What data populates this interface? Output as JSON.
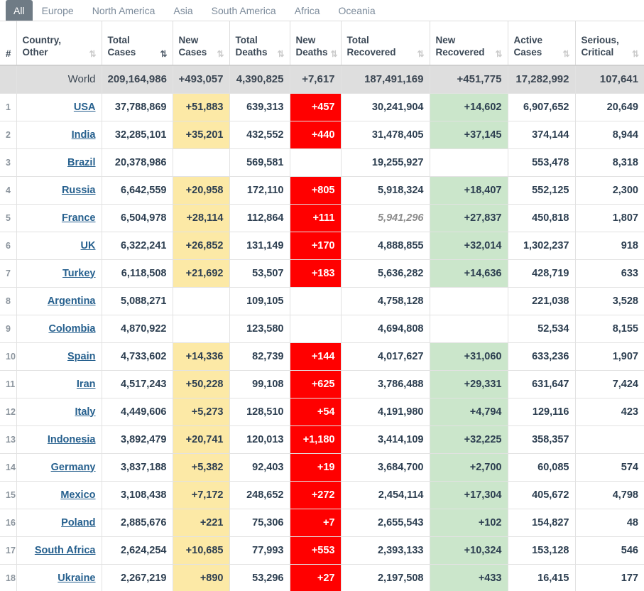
{
  "tabs": [
    {
      "label": "All",
      "active": true
    },
    {
      "label": "Europe",
      "active": false
    },
    {
      "label": "North America",
      "active": false
    },
    {
      "label": "Asia",
      "active": false
    },
    {
      "label": "South America",
      "active": false
    },
    {
      "label": "Africa",
      "active": false
    },
    {
      "label": "Oceania",
      "active": false
    }
  ],
  "columns": [
    {
      "label": "#",
      "sort": "none"
    },
    {
      "label": "Country,\nOther",
      "line1": "Country,",
      "line2": "Other",
      "sort": "both"
    },
    {
      "label": "Total Cases",
      "line1": "Total",
      "line2": "Cases",
      "sort": "desc-active"
    },
    {
      "label": "New Cases",
      "line1": "New",
      "line2": "Cases",
      "sort": "both"
    },
    {
      "label": "Total Deaths",
      "line1": "Total",
      "line2": "Deaths",
      "sort": "both"
    },
    {
      "label": "New Deaths",
      "line1": "New",
      "line2": "Deaths",
      "sort": "both"
    },
    {
      "label": "Total Recovered",
      "line1": "Total",
      "line2": "Recovered",
      "sort": "both"
    },
    {
      "label": "New Recovered",
      "line1": "New",
      "line2": "Recovered",
      "sort": "both"
    },
    {
      "label": "Active Cases",
      "line1": "Active",
      "line2": "Cases",
      "sort": "both"
    },
    {
      "label": "Serious, Critical",
      "line1": "Serious,",
      "line2": "Critical",
      "sort": "both"
    }
  ],
  "sort_icons": {
    "both": "⇅",
    "desc_active": "⇅",
    "none": ""
  },
  "world_row": {
    "rank": "",
    "country": "World",
    "total_cases": "209,164,986",
    "new_cases": "+493,057",
    "total_deaths": "4,390,825",
    "new_deaths": "+7,617",
    "total_recovered": "187,491,169",
    "new_recovered": "+451,775",
    "active_cases": "17,282,992",
    "serious_critical": "107,641"
  },
  "rows": [
    {
      "rank": "1",
      "country": "USA",
      "total_cases": "37,788,869",
      "new_cases": "+51,883",
      "total_deaths": "639,313",
      "new_deaths": "+457",
      "total_recovered": "30,241,904",
      "new_recovered": "+14,602",
      "active_cases": "6,907,652",
      "serious_critical": "20,649",
      "recovered_estimated": false
    },
    {
      "rank": "2",
      "country": "India",
      "total_cases": "32,285,101",
      "new_cases": "+35,201",
      "total_deaths": "432,552",
      "new_deaths": "+440",
      "total_recovered": "31,478,405",
      "new_recovered": "+37,145",
      "active_cases": "374,144",
      "serious_critical": "8,944",
      "recovered_estimated": false
    },
    {
      "rank": "3",
      "country": "Brazil",
      "total_cases": "20,378,986",
      "new_cases": "",
      "total_deaths": "569,581",
      "new_deaths": "",
      "total_recovered": "19,255,927",
      "new_recovered": "",
      "active_cases": "553,478",
      "serious_critical": "8,318",
      "recovered_estimated": false
    },
    {
      "rank": "4",
      "country": "Russia",
      "total_cases": "6,642,559",
      "new_cases": "+20,958",
      "total_deaths": "172,110",
      "new_deaths": "+805",
      "total_recovered": "5,918,324",
      "new_recovered": "+18,407",
      "active_cases": "552,125",
      "serious_critical": "2,300",
      "recovered_estimated": false
    },
    {
      "rank": "5",
      "country": "France",
      "total_cases": "6,504,978",
      "new_cases": "+28,114",
      "total_deaths": "112,864",
      "new_deaths": "+111",
      "total_recovered": "5,941,296",
      "new_recovered": "+27,837",
      "active_cases": "450,818",
      "serious_critical": "1,807",
      "recovered_estimated": true
    },
    {
      "rank": "6",
      "country": "UK",
      "total_cases": "6,322,241",
      "new_cases": "+26,852",
      "total_deaths": "131,149",
      "new_deaths": "+170",
      "total_recovered": "4,888,855",
      "new_recovered": "+32,014",
      "active_cases": "1,302,237",
      "serious_critical": "918",
      "recovered_estimated": false
    },
    {
      "rank": "7",
      "country": "Turkey",
      "total_cases": "6,118,508",
      "new_cases": "+21,692",
      "total_deaths": "53,507",
      "new_deaths": "+183",
      "total_recovered": "5,636,282",
      "new_recovered": "+14,636",
      "active_cases": "428,719",
      "serious_critical": "633",
      "recovered_estimated": false
    },
    {
      "rank": "8",
      "country": "Argentina",
      "total_cases": "5,088,271",
      "new_cases": "",
      "total_deaths": "109,105",
      "new_deaths": "",
      "total_recovered": "4,758,128",
      "new_recovered": "",
      "active_cases": "221,038",
      "serious_critical": "3,528",
      "recovered_estimated": false
    },
    {
      "rank": "9",
      "country": "Colombia",
      "total_cases": "4,870,922",
      "new_cases": "",
      "total_deaths": "123,580",
      "new_deaths": "",
      "total_recovered": "4,694,808",
      "new_recovered": "",
      "active_cases": "52,534",
      "serious_critical": "8,155",
      "recovered_estimated": false
    },
    {
      "rank": "10",
      "country": "Spain",
      "total_cases": "4,733,602",
      "new_cases": "+14,336",
      "total_deaths": "82,739",
      "new_deaths": "+144",
      "total_recovered": "4,017,627",
      "new_recovered": "+31,060",
      "active_cases": "633,236",
      "serious_critical": "1,907",
      "recovered_estimated": false
    },
    {
      "rank": "11",
      "country": "Iran",
      "total_cases": "4,517,243",
      "new_cases": "+50,228",
      "total_deaths": "99,108",
      "new_deaths": "+625",
      "total_recovered": "3,786,488",
      "new_recovered": "+29,331",
      "active_cases": "631,647",
      "serious_critical": "7,424",
      "recovered_estimated": false
    },
    {
      "rank": "12",
      "country": "Italy",
      "total_cases": "4,449,606",
      "new_cases": "+5,273",
      "total_deaths": "128,510",
      "new_deaths": "+54",
      "total_recovered": "4,191,980",
      "new_recovered": "+4,794",
      "active_cases": "129,116",
      "serious_critical": "423",
      "recovered_estimated": false
    },
    {
      "rank": "13",
      "country": "Indonesia",
      "total_cases": "3,892,479",
      "new_cases": "+20,741",
      "total_deaths": "120,013",
      "new_deaths": "+1,180",
      "total_recovered": "3,414,109",
      "new_recovered": "+32,225",
      "active_cases": "358,357",
      "serious_critical": "",
      "recovered_estimated": false
    },
    {
      "rank": "14",
      "country": "Germany",
      "total_cases": "3,837,188",
      "new_cases": "+5,382",
      "total_deaths": "92,403",
      "new_deaths": "+19",
      "total_recovered": "3,684,700",
      "new_recovered": "+2,700",
      "active_cases": "60,085",
      "serious_critical": "574",
      "recovered_estimated": false
    },
    {
      "rank": "15",
      "country": "Mexico",
      "total_cases": "3,108,438",
      "new_cases": "+7,172",
      "total_deaths": "248,652",
      "new_deaths": "+272",
      "total_recovered": "2,454,114",
      "new_recovered": "+17,304",
      "active_cases": "405,672",
      "serious_critical": "4,798",
      "recovered_estimated": false
    },
    {
      "rank": "16",
      "country": "Poland",
      "total_cases": "2,885,676",
      "new_cases": "+221",
      "total_deaths": "75,306",
      "new_deaths": "+7",
      "total_recovered": "2,655,543",
      "new_recovered": "+102",
      "active_cases": "154,827",
      "serious_critical": "48",
      "recovered_estimated": false
    },
    {
      "rank": "17",
      "country": "South Africa",
      "total_cases": "2,624,254",
      "new_cases": "+10,685",
      "total_deaths": "77,993",
      "new_deaths": "+553",
      "total_recovered": "2,393,133",
      "new_recovered": "+10,324",
      "active_cases": "153,128",
      "serious_critical": "546",
      "recovered_estimated": false
    },
    {
      "rank": "18",
      "country": "Ukraine",
      "total_cases": "2,267,219",
      "new_cases": "+890",
      "total_deaths": "53,296",
      "new_deaths": "+27",
      "total_recovered": "2,197,508",
      "new_recovered": "+433",
      "active_cases": "16,415",
      "serious_critical": "177",
      "recovered_estimated": false
    }
  ],
  "colors": {
    "new_cases_highlight": "#fce9a6",
    "new_deaths_highlight": "#ff0000",
    "new_recovered_highlight": "#cbe6cb",
    "world_row_bg": "#dedede",
    "link": "#26608e",
    "active_tab_bg": "#6f7b85"
  }
}
